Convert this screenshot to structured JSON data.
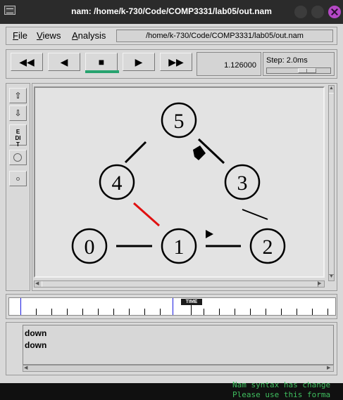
{
  "window": {
    "title": "nam: /home/k-730/Code/COMP3331/lab05/out.nam",
    "close_color": "#b548c6"
  },
  "menubar": {
    "items": [
      {
        "label": "File",
        "ul": "F",
        "rest": "ile"
      },
      {
        "label": "Views",
        "ul": "V",
        "rest": "iews"
      },
      {
        "label": "Analysis",
        "ul": "A",
        "rest": "nalysis"
      }
    ],
    "filename": "/home/k-730/Code/COMP3331/lab05/out.nam"
  },
  "controls": {
    "rewind": "◀◀",
    "back": "◀",
    "stop": "■",
    "play": "▶",
    "fast_forward": "▶▶",
    "time": "1.126000",
    "step_label": "Step: 2.0ms",
    "active_color": "#27a36f"
  },
  "tools": {
    "edit_label": "EDIT"
  },
  "network": {
    "nodes": [
      {
        "id": "0",
        "label": "0"
      },
      {
        "id": "1",
        "label": "1"
      },
      {
        "id": "2",
        "label": "2"
      },
      {
        "id": "3",
        "label": "3"
      },
      {
        "id": "4",
        "label": "4"
      },
      {
        "id": "5",
        "label": "5"
      }
    ],
    "links": [
      {
        "from": "0",
        "to": "1",
        "state": "up"
      },
      {
        "from": "1",
        "to": "2",
        "state": "up"
      },
      {
        "from": "2",
        "to": "3",
        "state": "up"
      },
      {
        "from": "3",
        "to": "5",
        "state": "up"
      },
      {
        "from": "5",
        "to": "4",
        "state": "up"
      },
      {
        "from": "4",
        "to": "1",
        "state": "down"
      }
    ],
    "down_link_color": "#e01010"
  },
  "timeline": {
    "marker_label": "TIME",
    "blue_color": "#1a1ae0"
  },
  "log": {
    "lines": [
      "down",
      "down"
    ]
  },
  "terminal": {
    "lines": [
      "Nam syntax has change",
      "Please use this forma"
    ],
    "color": "#3fbf5f"
  }
}
